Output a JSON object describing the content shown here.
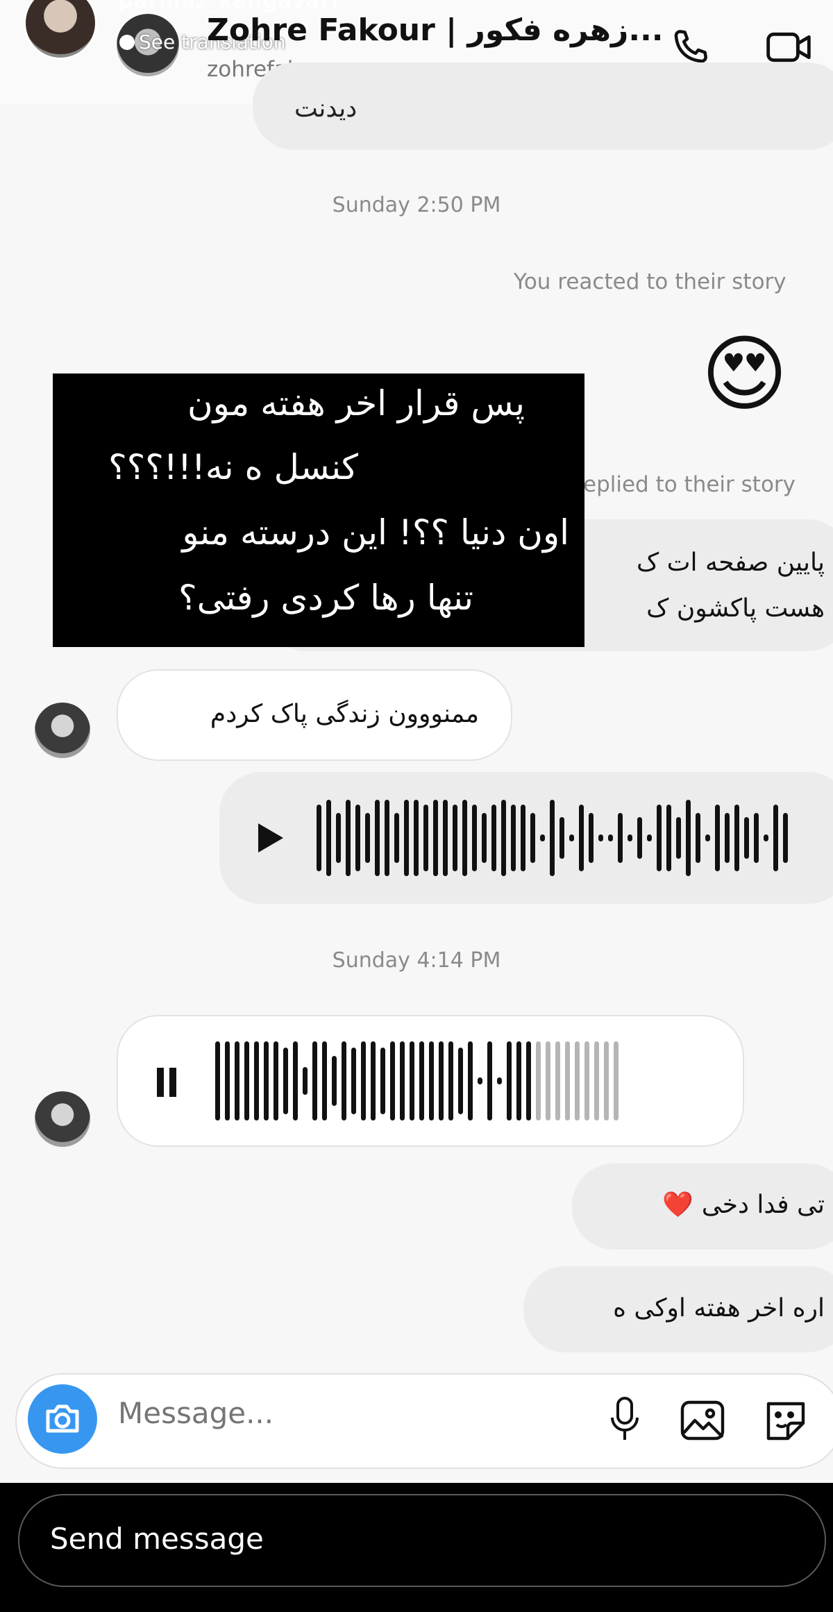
{
  "header": {
    "story_username": "parinaz_kangavari",
    "see_translation": "See translation",
    "chat_name": "Zohre Fakour | زهره فکور...",
    "chat_handle": "zohrefakour",
    "call_icon": "phone-icon",
    "video_icon": "video-camera-icon"
  },
  "messages": {
    "clipped_top_text": "دیدنت",
    "timestamp_1": "Sunday 2:50 PM",
    "reacted_story": "You reacted to their story",
    "reaction_emoji": "😍",
    "replied_story": "eplied to their story",
    "reply_line_1": "پایین صفحه ات ک",
    "reply_line_2": "هست پاکشون ک",
    "incoming_1": "ممنووون زندگی پاک کردم",
    "voice_out_play": "play-icon",
    "timestamp_2": "Sunday 4:14 PM",
    "voice_in_pause": "pause-icon",
    "outgoing_2": "تی فدا دخی ❤️",
    "outgoing_3": "اره اخر هفته اوکی ه"
  },
  "overlay_caption": {
    "line_1": "پس قرار اخر هفته مون",
    "line_2": "کنسل ه نه!!!؟؟؟",
    "line_3": "اون دنیا ؟؟! این درسته منو",
    "line_4": "تنها رها کردی رفتی؟"
  },
  "composer": {
    "placeholder": "Message...",
    "icons": [
      "camera-icon",
      "microphone-icon",
      "gallery-icon",
      "sticker-icon"
    ]
  },
  "story_reply": {
    "placeholder": "Send message"
  },
  "colors": {
    "accent_blue": "#3797f0",
    "heart_red": "#e0191f"
  }
}
